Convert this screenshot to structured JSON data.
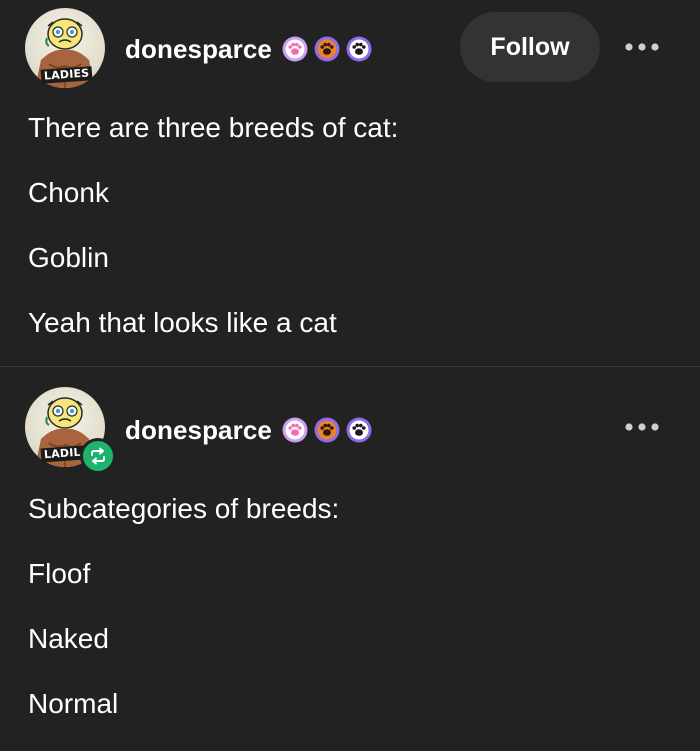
{
  "posts": [
    {
      "avatar_caption": "LADIES",
      "username": "donesparce",
      "badges": [
        {
          "icon": "paw-pink-badge-icon",
          "color": "#c9a0f0"
        },
        {
          "icon": "paw-orange-badge-icon",
          "color": "#f0812b"
        },
        {
          "icon": "paw-black-badge-icon",
          "color": "#8c6ce8"
        }
      ],
      "follow_label": "Follow",
      "more_icon": "more-options-icon",
      "paragraphs": [
        "There are three breeds of cat:",
        "Chonk",
        "Goblin",
        "Yeah that looks like a cat"
      ]
    },
    {
      "avatar_caption": "LADIL",
      "reblog_icon": "reblog-icon",
      "username": "donesparce",
      "badges": [
        {
          "icon": "paw-pink-badge-icon",
          "color": "#c9a0f0"
        },
        {
          "icon": "paw-orange-badge-icon",
          "color": "#f0812b"
        },
        {
          "icon": "paw-black-badge-icon",
          "color": "#8c6ce8"
        }
      ],
      "more_icon": "more-options-icon",
      "paragraphs": [
        "Subcategories of breeds:",
        "Floof",
        "Naked",
        "Normal"
      ]
    }
  ],
  "colors": {
    "background": "#222222",
    "text": "#ffffff",
    "follow_button": "#333333",
    "reblog_green": "#1db36e",
    "divider": "#3a3a3a"
  }
}
